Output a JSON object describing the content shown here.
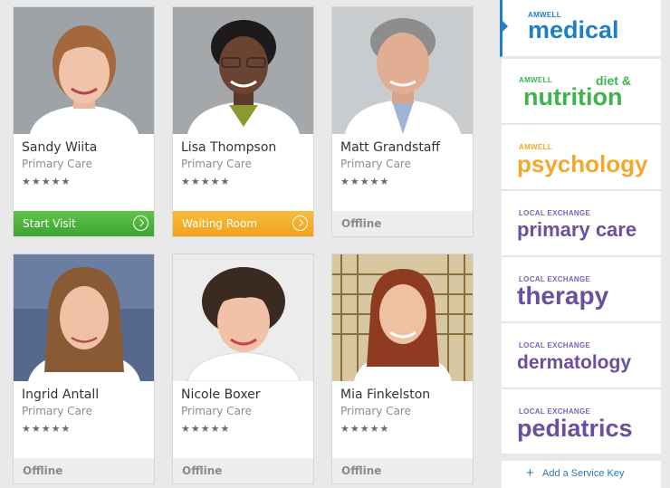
{
  "providers": [
    {
      "name": "Sandy Wiita",
      "specialty": "Primary Care",
      "stars": "★★★★★",
      "action": "Start Visit",
      "status": "green"
    },
    {
      "name": "Lisa Thompson",
      "specialty": "Primary Care",
      "stars": "★★★★★",
      "action": "Waiting Room",
      "status": "orange"
    },
    {
      "name": "Matt Grandstaff",
      "specialty": "Primary Care",
      "stars": "★★★★★",
      "action": "Offline",
      "status": "offline"
    },
    {
      "name": "Ingrid Antall",
      "specialty": "Primary Care",
      "stars": "★★★★★",
      "action": "Offline",
      "status": "offline"
    },
    {
      "name": "Nicole Boxer",
      "specialty": "Primary Care",
      "stars": "★★★★★",
      "action": "Offline",
      "status": "offline"
    },
    {
      "name": "Mia Finkelston",
      "specialty": "Primary Care",
      "stars": "★★★★★",
      "action": "Offline",
      "status": "offline"
    }
  ],
  "services": [
    {
      "label": "AMWELL",
      "name": "medical",
      "color": "#1e7fc4"
    },
    {
      "label": "AMWELL",
      "name_top": "diet &",
      "name": "nutrition",
      "color": "#3db34a"
    },
    {
      "label": "AMWELL",
      "name": "psychology",
      "color": "#f2a82c"
    },
    {
      "label": "LOCAL EXCHANGE",
      "name": "primary care",
      "color": "#6a4fa0"
    },
    {
      "label": "LOCAL EXCHANGE",
      "name": "therapy",
      "color": "#6a4fa0"
    },
    {
      "label": "LOCAL EXCHANGE",
      "name": "dermatology",
      "color": "#6a4fa0"
    },
    {
      "label": "LOCAL EXCHANGE",
      "name": "pediatrics",
      "color": "#6a4fa0"
    }
  ],
  "add_service_key": "Add a Service Key",
  "colors": {
    "start_visit": "#4db33b",
    "waiting_room": "#f2ab27",
    "active_service_accent": "#1e7fc4"
  }
}
